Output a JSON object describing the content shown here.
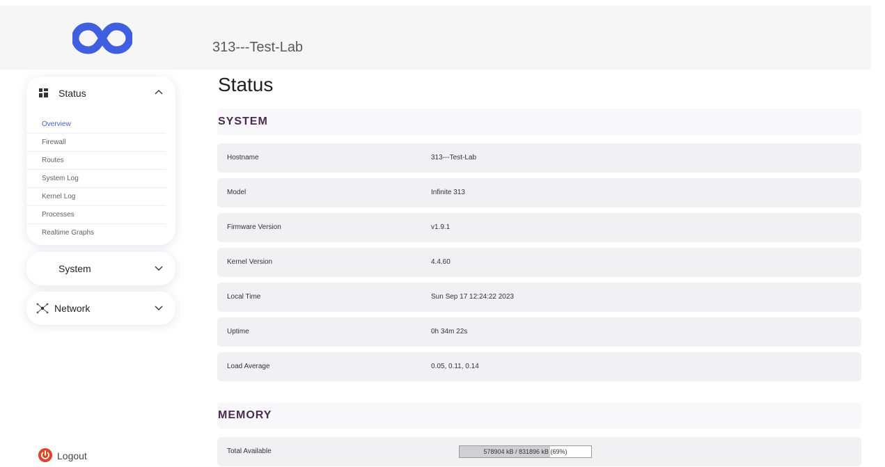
{
  "header": {
    "title": "313---Test-Lab",
    "logo": "infinity-logo"
  },
  "sidebar": {
    "status": {
      "label": "Status",
      "icon": "dashboard-grid-icon",
      "items": [
        "Overview",
        "Firewall",
        "Routes",
        "System Log",
        "Kernel Log",
        "Processes",
        "Realtime Graphs"
      ]
    },
    "system": {
      "label": "System"
    },
    "network": {
      "label": "Network",
      "icon": "network-nodes-icon"
    },
    "logout": {
      "label": "Logout",
      "icon": "power-icon"
    }
  },
  "main": {
    "title": "Status",
    "system_section": {
      "title": "SYSTEM",
      "rows": [
        {
          "key": "Hostname",
          "value": "313---Test-Lab"
        },
        {
          "key": "Model",
          "value": "Infinite 313"
        },
        {
          "key": "Firmware Version",
          "value": "v1.9.1"
        },
        {
          "key": "Kernel Version",
          "value": "4.4.60"
        },
        {
          "key": "Local Time",
          "value": "Sun Sep 17 12:24:22 2023"
        },
        {
          "key": "Uptime",
          "value": "0h 34m 22s"
        },
        {
          "key": "Load Average",
          "value": "0.05, 0.11, 0.14"
        }
      ]
    },
    "memory_section": {
      "title": "MEMORY",
      "total_available": {
        "key": "Total Available",
        "text": "578904 kB / 831896 kB (69%)",
        "percent": 69
      }
    }
  },
  "colors": {
    "accent_title": "#4b2a50",
    "logo_blue": "#3f5ee0",
    "logout_red": "#e0452b"
  }
}
